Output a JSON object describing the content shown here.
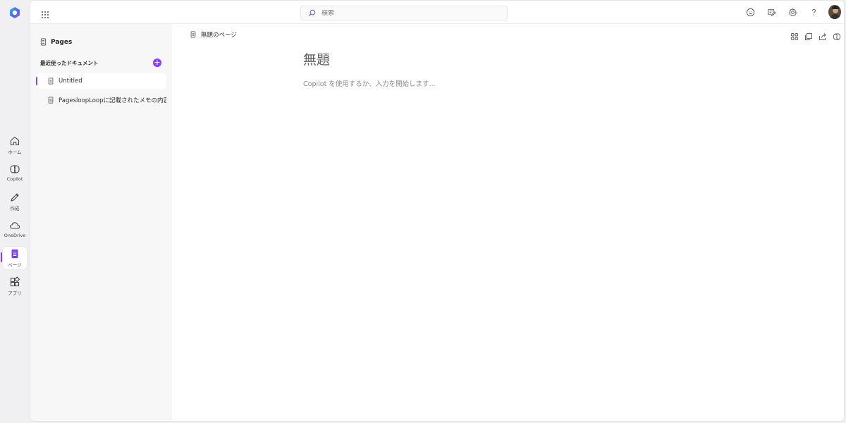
{
  "rail": {
    "items": [
      {
        "label": "ホーム",
        "icon": "home-icon"
      },
      {
        "label": "Copilot",
        "icon": "copilot-icon"
      },
      {
        "label": "作成",
        "icon": "pen-icon"
      },
      {
        "label": "OneDrive",
        "icon": "cloud-icon"
      },
      {
        "label": "ページ",
        "icon": "pages-icon",
        "active": true
      },
      {
        "label": "アプリ",
        "icon": "apps-icon"
      }
    ]
  },
  "topbar": {
    "search_placeholder": "検索",
    "icons": [
      "smiley-icon",
      "feedback-icon",
      "gear-icon",
      "help-icon",
      "avatar"
    ]
  },
  "sidebar": {
    "title": "Pages",
    "section_label": "最近使ったドキュメント",
    "add_label": "+",
    "items": [
      {
        "label": "Untitled",
        "active": true
      },
      {
        "label": "PagesloopLoopに記載されたメモの内容をまとめる"
      }
    ]
  },
  "page": {
    "breadcrumb": "無題のページ",
    "title": "無題",
    "placeholder": "Copilot を使用するか、入力を開始します..."
  },
  "colors": {
    "accent": "#8a3ffc",
    "rail_bg": "#f0f0f2",
    "sidebar_bg": "#f7f7f8"
  }
}
